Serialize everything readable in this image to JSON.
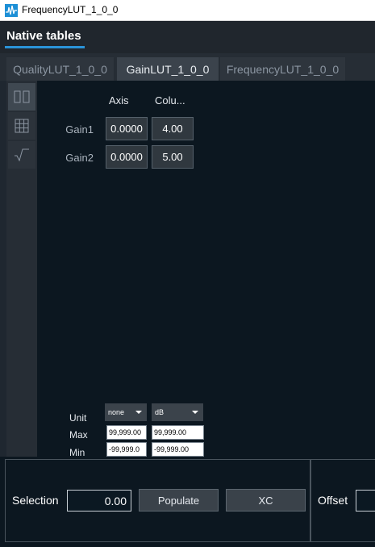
{
  "window": {
    "title": "FrequencyLUT_1_0_0"
  },
  "header": {
    "title": "Native tables"
  },
  "tabs": [
    {
      "label": "QualityLUT_1_0_0"
    },
    {
      "label": "GainLUT_1_0_0"
    },
    {
      "label": "FrequencyLUT_1_0_0"
    }
  ],
  "sidebar": {
    "buttons": [
      {
        "icon": "split-columns-icon",
        "active": true
      },
      {
        "icon": "grid-icon",
        "active": false
      },
      {
        "icon": "sqrt-icon",
        "active": false
      }
    ]
  },
  "table": {
    "columns": [
      "Axis",
      "Colu..."
    ],
    "rows": [
      {
        "label": "Gain1",
        "axis": "0.0000",
        "value": "4.00"
      },
      {
        "label": "Gain2",
        "axis": "0.0000",
        "value": "5.00"
      }
    ]
  },
  "props": {
    "unit_label": "Unit",
    "max_label": "Max",
    "min_label": "Min",
    "axis_unit": "none",
    "col_unit": "dB",
    "axis_max": "99,999.00",
    "col_max": "99,999.00",
    "axis_min": "-99,999.0",
    "col_min": "-99,999.00"
  },
  "bottom": {
    "selection_label": "Selection",
    "selection_value": "0.00",
    "populate_label": "Populate",
    "xc_label": "XC",
    "offset_label": "Offset"
  }
}
